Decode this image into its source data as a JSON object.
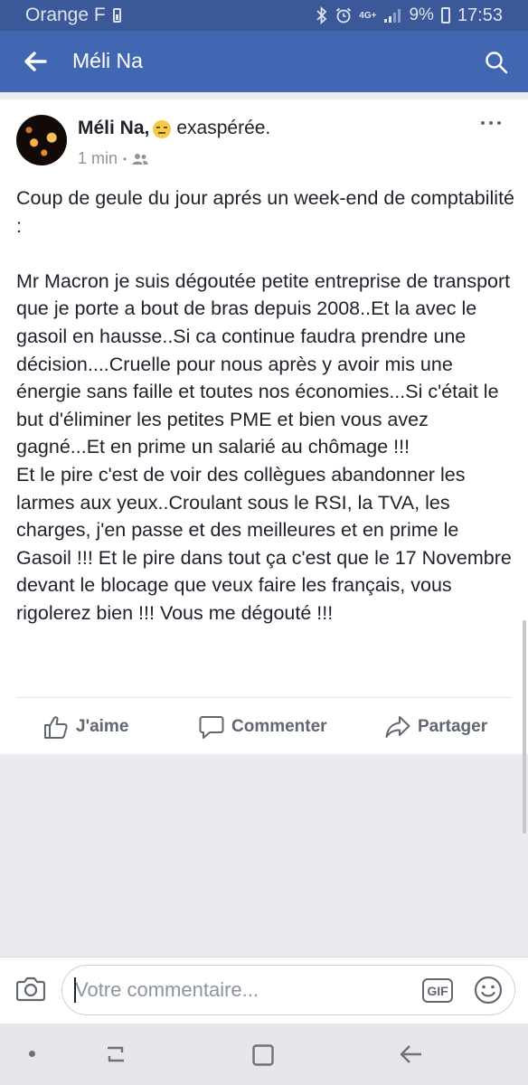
{
  "status_bar": {
    "carrier": "Orange F",
    "network": "4G+",
    "battery": "9%",
    "time": "17:53",
    "icons": [
      "bluetooth-icon",
      "alarm-icon",
      "signal-icon",
      "battery-icon"
    ]
  },
  "app_bar": {
    "title": "Méli Na",
    "back_icon": "arrow-left-icon",
    "search_icon": "search-icon"
  },
  "post": {
    "author": "Méli Na,",
    "feeling": "exaspérée.",
    "feeling_icon": "annoyed-face-emoji",
    "time": "1 min",
    "audience_icon": "friends-icon",
    "text": "Coup de geule du jour aprés un week-end de comptabilité :\n\nMr Macron je suis dégoutée petite entreprise de transport que je porte a bout de bras depuis 2008..Et la avec le gasoil en hausse..Si ca continue faudra prendre une décision....Cruelle pour nous après y avoir mis une énergie sans faille et toutes nos économies...Si c'était le but d'éliminer les petites PME et bien vous avez gagné...Et en prime un salarié au chômage !!!\nEt le pire c'est de voir des collègues abandonner les larmes aux yeux..Croulant sous le RSI, la TVA, les charges, j'en passe et des meilleures et en prime le Gasoil !!! Et le pire dans tout ça c'est que le 17 Novembre devant le blocage que veux faire les français, vous rigolerez bien !!! Vous me dégouté !!!",
    "actions": {
      "like": "J'aime",
      "comment": "Commenter",
      "share": "Partager"
    }
  },
  "composer": {
    "placeholder": "Votre commentaire...",
    "gif_label": "GIF",
    "camera_icon": "camera-icon",
    "emoji_icon": "smiley-icon"
  },
  "colors": {
    "status_bar": "#3b5998",
    "app_bar": "#4267b2",
    "text": "#1d2129",
    "secondary_text": "#90949c",
    "background": "#e9ebee"
  }
}
